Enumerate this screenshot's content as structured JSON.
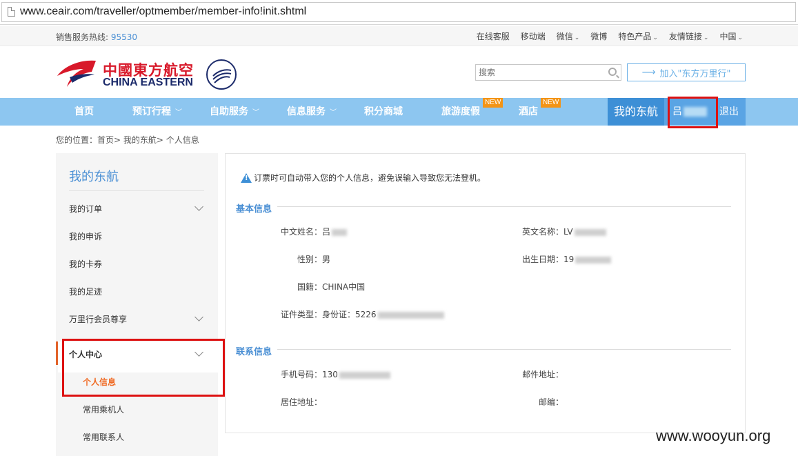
{
  "browser": {
    "url": "www.ceair.com/traveller/optmember/member-info!init.shtml"
  },
  "topbar": {
    "hotline_label": "销售服务热线:",
    "hotline_number": "95530",
    "links": [
      {
        "label": "在线客服",
        "caret": false
      },
      {
        "label": "移动端",
        "caret": false
      },
      {
        "label": "微信",
        "caret": true
      },
      {
        "label": "微博",
        "caret": false
      },
      {
        "label": "特色产品",
        "caret": true
      },
      {
        "label": "友情链接",
        "caret": true
      },
      {
        "label": "中国",
        "caret": true
      }
    ]
  },
  "header": {
    "logo_cn": "中國東方航空",
    "logo_en": "CHINA EASTERN",
    "skyteam": "SKYTEAM",
    "search_placeholder": "搜索",
    "join_label": "加入\"东方万里行\"",
    "colors": {
      "brand_red": "#d8192a",
      "brand_navy": "#1b2a6a",
      "accent_blue": "#4a8fd4"
    }
  },
  "nav": {
    "items": [
      {
        "label": "首页"
      },
      {
        "label": "预订行程",
        "dropdown": true
      },
      {
        "label": "自助服务",
        "dropdown": true
      },
      {
        "label": "信息服务",
        "dropdown": true
      },
      {
        "label": "积分商城"
      },
      {
        "label": "旅游度假",
        "badge": "NEW"
      },
      {
        "label": "酒店",
        "badge": "NEW"
      }
    ],
    "mine": "我的东航",
    "user_prefix": "吕",
    "logout": "退出"
  },
  "breadcrumb": "您的位置：首页> 我的东航> 个人信息",
  "sidebar": {
    "title": "我的东航",
    "items": [
      {
        "label": "我的订单",
        "chevron": true
      },
      {
        "label": "我的申诉",
        "chevron": false
      },
      {
        "label": "我的卡券",
        "chevron": false
      },
      {
        "label": "我的足迹",
        "chevron": false
      },
      {
        "label": "万里行会员尊享",
        "chevron": true
      },
      {
        "label": "个人中心",
        "chevron": true
      }
    ],
    "sub_items": [
      {
        "label": "个人信息",
        "active": true
      },
      {
        "label": "常用乘机人",
        "active": false
      },
      {
        "label": "常用联系人",
        "active": false
      }
    ]
  },
  "main": {
    "notice": "订票时可自动带入您的个人信息，避免误输入导致您无法登机。",
    "basic_title": "基本信息",
    "basic": {
      "cn_name_label": "中文姓名：",
      "cn_name_value": "吕",
      "en_name_label": "英文名称：",
      "en_name_value": "LV",
      "gender_label": "性别：",
      "gender_value": "男",
      "birth_label": "出生日期：",
      "birth_value": "19",
      "nationality_label": "国籍：",
      "nationality_value": "CHINA中国",
      "id_label": "证件类型：",
      "id_value": "身份证：5226"
    },
    "contact_title": "联系信息",
    "contact": {
      "mobile_label": "手机号码：",
      "mobile_value": "130",
      "email_label": "邮件地址：",
      "email_value": "",
      "address_label": "居住地址：",
      "address_value": "",
      "zip_label": "邮编：",
      "zip_value": ""
    }
  },
  "watermark": "www.wooyun.org"
}
